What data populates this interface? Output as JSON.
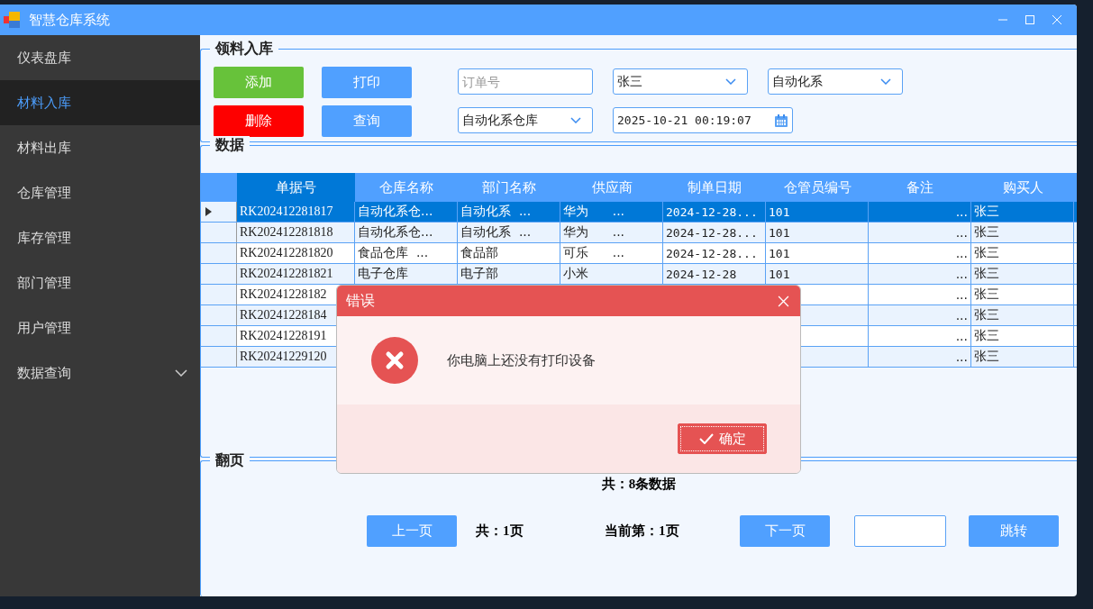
{
  "window": {
    "title": "智慧仓库系统"
  },
  "sidebar": {
    "items": [
      {
        "label": "仪表盘库",
        "selected": false
      },
      {
        "label": "材料入库",
        "selected": true
      },
      {
        "label": "材料出库",
        "selected": false
      },
      {
        "label": "仓库管理",
        "selected": false
      },
      {
        "label": "库存管理",
        "selected": false
      },
      {
        "label": "部门管理",
        "selected": false
      },
      {
        "label": "用户管理",
        "selected": false
      },
      {
        "label": "数据查询",
        "selected": false,
        "expandable": true
      }
    ]
  },
  "form": {
    "title": "领料入库",
    "buttons": [
      {
        "label": "添加",
        "kind": "add"
      },
      {
        "label": "打印",
        "kind": "normal"
      },
      {
        "label": "删除",
        "kind": "delete"
      },
      {
        "label": "查询",
        "kind": "normal"
      }
    ],
    "order_field": {
      "placeholder": "订单号"
    },
    "buyer": "张三",
    "department": "自动化系",
    "warehouse": "自动化系仓库",
    "date": "2025-10-21 00:19:07"
  },
  "data": {
    "title": "数据",
    "columns": [
      "单据号",
      "仓库名称",
      "部门名称",
      "供应商",
      "制单日期",
      "仓管员编号",
      "备注",
      "购买人"
    ],
    "rows": [
      {
        "selected": true,
        "cells": [
          "RK202412281817",
          "自动化系仓...",
          "自动化系  ...",
          "华为      ...",
          "2024-12-28...",
          "101",
          "...",
          "张三"
        ]
      },
      {
        "selected": false,
        "cells": [
          "RK202412281818",
          "自动化系仓...",
          "自动化系  ...",
          "华为      ...",
          "2024-12-28...",
          "101",
          "...",
          "张三"
        ]
      },
      {
        "selected": false,
        "cells": [
          "RK202412281820",
          "食品仓库  ...",
          "食品部",
          "可乐      ...",
          "2024-12-28...",
          "101",
          "...",
          "张三"
        ]
      },
      {
        "selected": false,
        "cells": [
          "RK202412281821",
          "电子仓库",
          "电子部",
          "小米",
          "2024-12-28",
          "101",
          "...",
          "张三"
        ]
      },
      {
        "selected": false,
        "cells": [
          "RK20241228182",
          "",
          "",
          "",
          "",
          "",
          "...",
          "张三"
        ]
      },
      {
        "selected": false,
        "cells": [
          "RK20241228184",
          "",
          "",
          "",
          "",
          "",
          "...",
          "张三"
        ]
      },
      {
        "selected": false,
        "cells": [
          "RK20241228191",
          "",
          "",
          "",
          "",
          "",
          "...",
          "张三"
        ]
      },
      {
        "selected": false,
        "cells": [
          "RK20241229120",
          "",
          "",
          "",
          "",
          "",
          "...",
          "张三"
        ]
      }
    ]
  },
  "paging": {
    "title": "翻页",
    "total_records": "共：8条数据",
    "prev": "上一页",
    "total_pages": "共：1页",
    "current": "当前第：1页",
    "next": "下一页",
    "jump": "跳转"
  },
  "dialog": {
    "title": "错误",
    "message": "你电脑上还没有打印设备",
    "ok": "确定"
  }
}
